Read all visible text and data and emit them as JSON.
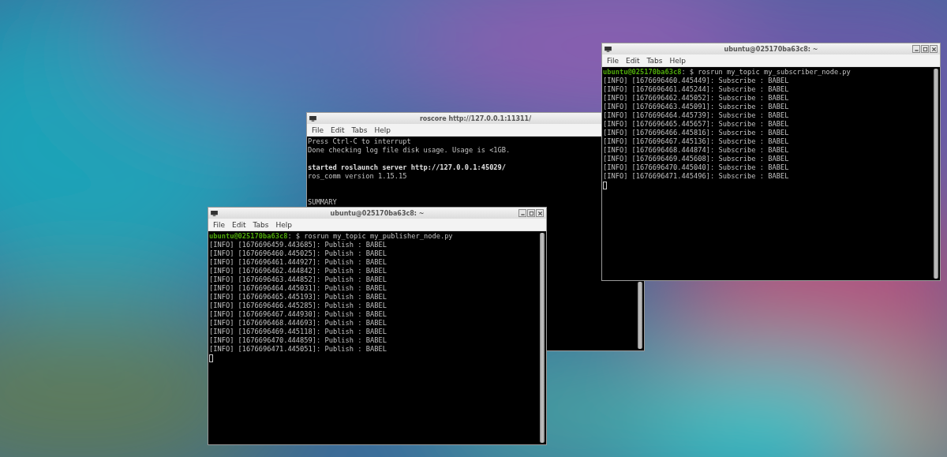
{
  "windows": [
    {
      "title": "roscore http://127.0.0.1:11311/",
      "menu": [
        "File",
        "Edit",
        "Tabs",
        "Help"
      ],
      "lines": [
        {
          "kind": "output",
          "text": "Press Ctrl-C to interrupt"
        },
        {
          "kind": "output",
          "text": "Done checking log file disk usage. Usage is <1GB."
        },
        {
          "kind": "blank"
        },
        {
          "kind": "bold",
          "text": "started roslaunch server http://127.0.0.1:45029/"
        },
        {
          "kind": "output",
          "text": "ros_comm version 1.15.15"
        },
        {
          "kind": "blank"
        },
        {
          "kind": "blank"
        },
        {
          "kind": "output",
          "text": "SUMMARY"
        }
      ]
    },
    {
      "title": "ubuntu@025170ba63c8: ~",
      "window_buttons": true,
      "menu": [
        "File",
        "Edit",
        "Tabs",
        "Help"
      ],
      "lines": [
        {
          "kind": "prompt",
          "prompt": "ubuntu@025170ba63c8",
          "text": ": $ rosrun my_topic my_publisher_node.py"
        },
        {
          "kind": "output",
          "text": "[INFO] [1676696459.443685]: Publish : BABEL"
        },
        {
          "kind": "output",
          "text": "[INFO] [1676696460.445025]: Publish : BABEL"
        },
        {
          "kind": "output",
          "text": "[INFO] [1676696461.444927]: Publish : BABEL"
        },
        {
          "kind": "output",
          "text": "[INFO] [1676696462.444842]: Publish : BABEL"
        },
        {
          "kind": "output",
          "text": "[INFO] [1676696463.444852]: Publish : BABEL"
        },
        {
          "kind": "output",
          "text": "[INFO] [1676696464.445031]: Publish : BABEL"
        },
        {
          "kind": "output",
          "text": "[INFO] [1676696465.445193]: Publish : BABEL"
        },
        {
          "kind": "output",
          "text": "[INFO] [1676696466.445285]: Publish : BABEL"
        },
        {
          "kind": "output",
          "text": "[INFO] [1676696467.444930]: Publish : BABEL"
        },
        {
          "kind": "output",
          "text": "[INFO] [1676696468.444693]: Publish : BABEL"
        },
        {
          "kind": "output",
          "text": "[INFO] [1676696469.445118]: Publish : BABEL"
        },
        {
          "kind": "output",
          "text": "[INFO] [1676696470.444859]: Publish : BABEL"
        },
        {
          "kind": "output",
          "text": "[INFO] [1676696471.445051]: Publish : BABEL"
        },
        {
          "kind": "cursor"
        }
      ]
    },
    {
      "title": "ubuntu@025170ba63c8: ~",
      "window_buttons": true,
      "menu": [
        "File",
        "Edit",
        "Tabs",
        "Help"
      ],
      "lines": [
        {
          "kind": "prompt",
          "prompt": "ubuntu@025170ba63c8",
          "text": ": $ rosrun my_topic my_subscriber_node.py"
        },
        {
          "kind": "output",
          "text": "[INFO] [1676696460.445449]: Subscribe : BABEL"
        },
        {
          "kind": "output",
          "text": "[INFO] [1676696461.445244]: Subscribe : BABEL"
        },
        {
          "kind": "output",
          "text": "[INFO] [1676696462.445052]: Subscribe : BABEL"
        },
        {
          "kind": "output",
          "text": "[INFO] [1676696463.445091]: Subscribe : BABEL"
        },
        {
          "kind": "output",
          "text": "[INFO] [1676696464.445739]: Subscribe : BABEL"
        },
        {
          "kind": "output",
          "text": "[INFO] [1676696465.445657]: Subscribe : BABEL"
        },
        {
          "kind": "output",
          "text": "[INFO] [1676696466.445816]: Subscribe : BABEL"
        },
        {
          "kind": "output",
          "text": "[INFO] [1676696467.445136]: Subscribe : BABEL"
        },
        {
          "kind": "output",
          "text": "[INFO] [1676696468.444874]: Subscribe : BABEL"
        },
        {
          "kind": "output",
          "text": "[INFO] [1676696469.445608]: Subscribe : BABEL"
        },
        {
          "kind": "output",
          "text": "[INFO] [1676696470.445040]: Subscribe : BABEL"
        },
        {
          "kind": "output",
          "text": "[INFO] [1676696471.445496]: Subscribe : BABEL"
        },
        {
          "kind": "cursor"
        }
      ]
    }
  ]
}
